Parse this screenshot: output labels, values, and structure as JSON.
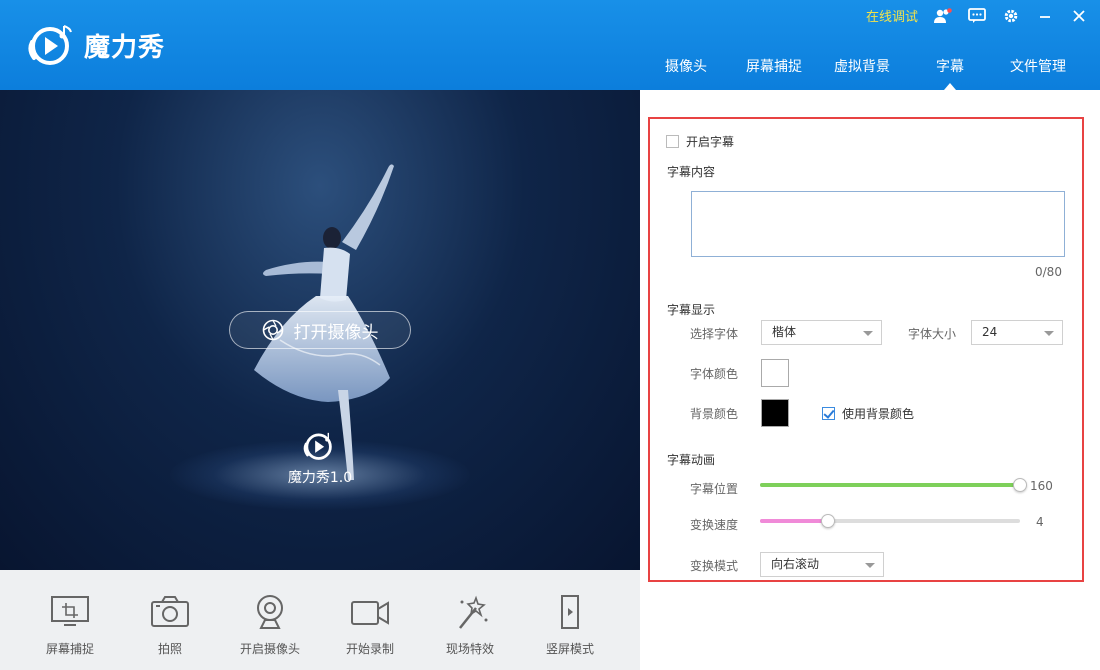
{
  "app": {
    "name": "魔力秀"
  },
  "topbar": {
    "online_debug": "在线调试"
  },
  "nav": {
    "tabs": [
      {
        "label": "摄像头"
      },
      {
        "label": "屏幕捕捉"
      },
      {
        "label": "虚拟背景"
      },
      {
        "label": "字幕",
        "active": true
      },
      {
        "label": "文件管理"
      }
    ]
  },
  "preview": {
    "open_camera": "打开摄像头",
    "brand": "魔力秀1.0"
  },
  "toolbar": {
    "items": [
      {
        "label": "屏幕捕捉",
        "icon": "screen-capture-icon"
      },
      {
        "label": "拍照",
        "icon": "camera-icon"
      },
      {
        "label": "开启摄像头",
        "icon": "webcam-icon"
      },
      {
        "label": "开始录制",
        "icon": "video-record-icon"
      },
      {
        "label": "现场特效",
        "icon": "magic-wand-icon"
      },
      {
        "label": "竖屏模式",
        "icon": "portrait-mode-icon"
      }
    ]
  },
  "subtitle": {
    "enable_label": "开启字幕",
    "enabled": false,
    "content_title": "字幕内容",
    "content_value": "",
    "char_count": "0/80",
    "display_title": "字幕显示",
    "font_label": "选择字体",
    "font_value": "楷体",
    "size_label": "字体大小",
    "size_value": "24",
    "font_color_label": "字体颜色",
    "font_color": "#ffffff",
    "bg_color_label": "背景颜色",
    "bg_color": "#000000",
    "use_bg_label": "使用背景颜色",
    "use_bg": true,
    "anim_title": "字幕动画",
    "position_label": "字幕位置",
    "position_value": "160",
    "position_fraction": 1.0,
    "speed_label": "变换速度",
    "speed_value": "4",
    "speed_fraction": 0.26,
    "mode_label": "变换模式",
    "mode_value": "向右滚动"
  },
  "colors": {
    "header": "#1890e8",
    "position_slider": "#7ed05a",
    "speed_slider": "#f08ad8",
    "highlight_border": "#e84343"
  }
}
